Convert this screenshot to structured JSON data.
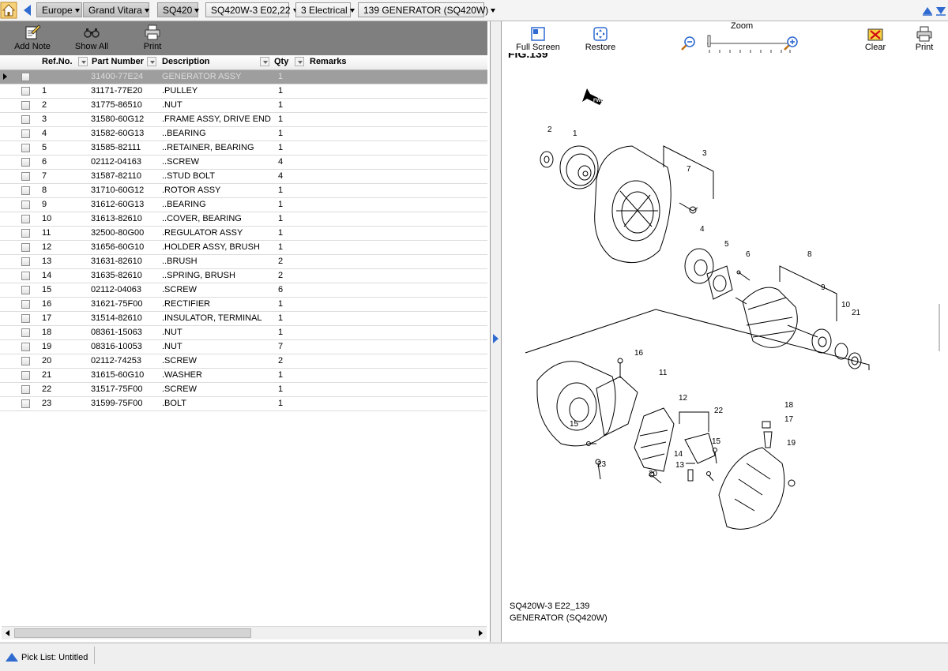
{
  "breadcrumbs": [
    {
      "label": "Europe"
    },
    {
      "label": "Grand Vitara"
    },
    {
      "label": "SQ420"
    },
    {
      "label": "SQ420W-3 E02,22"
    },
    {
      "label": "3 Electrical"
    },
    {
      "label": "139 GENERATOR (SQ420W)"
    }
  ],
  "left_toolbar": {
    "add_note": "Add Note",
    "show_all": "Show All",
    "print": "Print"
  },
  "columns": {
    "ref": "Ref.No.",
    "part": "Part Number",
    "desc": "Description",
    "qty": "Qty",
    "remarks": "Remarks"
  },
  "rows": [
    {
      "ref": "",
      "part": "31400-77E24",
      "desc": "GENERATOR ASSY",
      "qty": "1"
    },
    {
      "ref": "1",
      "part": "31171-77E20",
      "desc": ".PULLEY",
      "qty": "1"
    },
    {
      "ref": "2",
      "part": "31775-86510",
      "desc": ".NUT",
      "qty": "1"
    },
    {
      "ref": "3",
      "part": "31580-60G12",
      "desc": ".FRAME ASSY, DRIVE END",
      "qty": "1"
    },
    {
      "ref": "4",
      "part": "31582-60G13",
      "desc": "..BEARING",
      "qty": "1"
    },
    {
      "ref": "5",
      "part": "31585-82111",
      "desc": "..RETAINER, BEARING",
      "qty": "1"
    },
    {
      "ref": "6",
      "part": "02112-04163",
      "desc": "..SCREW",
      "qty": "4"
    },
    {
      "ref": "7",
      "part": "31587-82110",
      "desc": "..STUD BOLT",
      "qty": "4"
    },
    {
      "ref": "8",
      "part": "31710-60G12",
      "desc": ".ROTOR ASSY",
      "qty": "1"
    },
    {
      "ref": "9",
      "part": "31612-60G13",
      "desc": "..BEARING",
      "qty": "1"
    },
    {
      "ref": "10",
      "part": "31613-82610",
      "desc": "..COVER, BEARING",
      "qty": "1"
    },
    {
      "ref": "11",
      "part": "32500-80G00",
      "desc": ".REGULATOR ASSY",
      "qty": "1"
    },
    {
      "ref": "12",
      "part": "31656-60G10",
      "desc": ".HOLDER ASSY, BRUSH",
      "qty": "1"
    },
    {
      "ref": "13",
      "part": "31631-82610",
      "desc": "..BRUSH",
      "qty": "2"
    },
    {
      "ref": "14",
      "part": "31635-82610",
      "desc": "..SPRING, BRUSH",
      "qty": "2"
    },
    {
      "ref": "15",
      "part": "02112-04063",
      "desc": ".SCREW",
      "qty": "6"
    },
    {
      "ref": "16",
      "part": "31621-75F00",
      "desc": ".RECTIFIER",
      "qty": "1"
    },
    {
      "ref": "17",
      "part": "31514-82610",
      "desc": ".INSULATOR, TERMINAL",
      "qty": "1"
    },
    {
      "ref": "18",
      "part": "08361-15063",
      "desc": ".NUT",
      "qty": "1"
    },
    {
      "ref": "19",
      "part": "08316-10053",
      "desc": ".NUT",
      "qty": "7"
    },
    {
      "ref": "20",
      "part": "02112-74253",
      "desc": ".SCREW",
      "qty": "2"
    },
    {
      "ref": "21",
      "part": "31615-60G10",
      "desc": ".WASHER",
      "qty": "1"
    },
    {
      "ref": "22",
      "part": "31517-75F00",
      "desc": ".SCREW",
      "qty": "1"
    },
    {
      "ref": "23",
      "part": "31599-75F00",
      "desc": ".BOLT",
      "qty": "1"
    }
  ],
  "right_toolbar": {
    "full_screen": "Full Screen",
    "restore": "Restore",
    "zoom": "Zoom",
    "clear": "Clear",
    "print": "Print"
  },
  "figure": {
    "partial_heading": "FIG.139",
    "fwd_label": "FWD",
    "callouts": [
      "1",
      "2",
      "3",
      "4",
      "5",
      "6",
      "7",
      "8",
      "9",
      "10",
      "11",
      "12",
      "13",
      "14",
      "15",
      "15",
      "16",
      "17",
      "18",
      "19",
      "20",
      "21",
      "22",
      "23"
    ],
    "code": "SQ420W-3 E22_139",
    "name": "GENERATOR (SQ420W)"
  },
  "status": {
    "pick_list": "Pick List: Untitled"
  },
  "colors": {
    "toolbar_gray": "#7f7f7f",
    "selected_row": "#9e9e9e",
    "accent_blue": "#2f6bd0",
    "home_orange": "#f0a020"
  }
}
